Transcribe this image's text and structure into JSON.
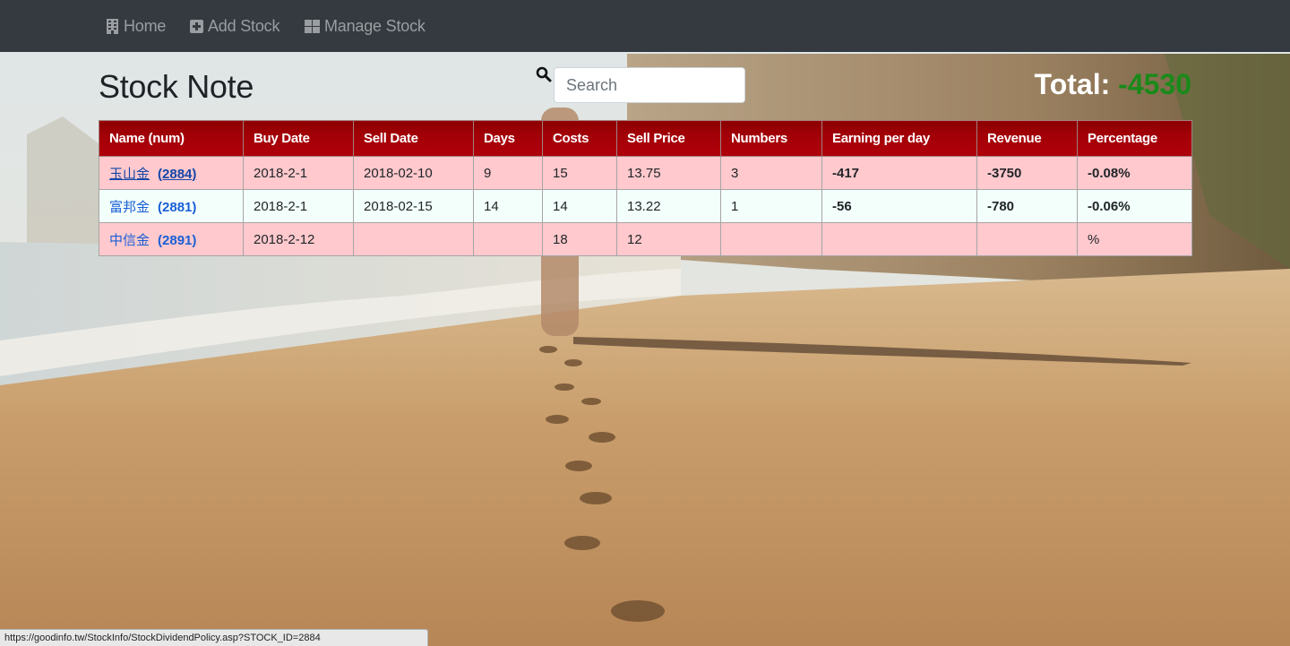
{
  "nav": {
    "items": [
      {
        "label": "Home",
        "icon": "building-icon"
      },
      {
        "label": "Add Stock",
        "icon": "plus-square-icon"
      },
      {
        "label": "Manage Stock",
        "icon": "grid-icon"
      }
    ]
  },
  "header": {
    "title": "Stock Note",
    "search_placeholder": "Search",
    "total_label": "Total:",
    "total_value": "-4530"
  },
  "table": {
    "columns": [
      "Name (num)",
      "Buy Date",
      "Sell Date",
      "Days",
      "Costs",
      "Sell Price",
      "Numbers",
      "Earning per day",
      "Revenue",
      "Percentage"
    ],
    "rows": [
      {
        "name": "玉山金",
        "num": "(2884)",
        "buy_date": "2018-2-1",
        "sell_date": "2018-02-10",
        "days": "9",
        "costs": "15",
        "sell_price": "13.75",
        "numbers": "3",
        "earning_per_day": "-417",
        "revenue": "-3750",
        "percentage": "-0.08%"
      },
      {
        "name": "富邦金",
        "num": "(2881)",
        "buy_date": "2018-2-1",
        "sell_date": "2018-02-15",
        "days": "14",
        "costs": "14",
        "sell_price": "13.22",
        "numbers": "1",
        "earning_per_day": "-56",
        "revenue": "-780",
        "percentage": "-0.06%"
      },
      {
        "name": "中信金",
        "num": "(2891)",
        "buy_date": "2018-2-12",
        "sell_date": "",
        "days": "",
        "costs": "18",
        "sell_price": "12",
        "numbers": "",
        "earning_per_day": "",
        "revenue": "",
        "percentage": "%"
      }
    ]
  },
  "status_bar": {
    "url": "https://goodinfo.tw/StockInfo/StockDividendPolicy.asp?STOCK_ID=2884"
  },
  "colors": {
    "navbar": "#343a40",
    "header_row": "#a30008",
    "row_pink": "#ffc9cd",
    "row_mint": "#f3fffb",
    "positive_total": "#1a8a1a"
  }
}
